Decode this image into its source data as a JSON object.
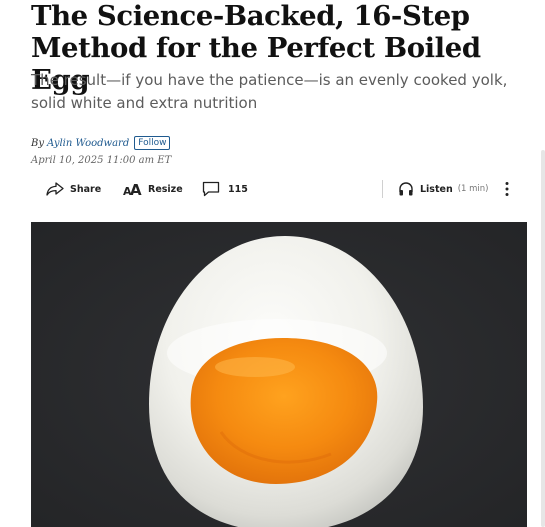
{
  "article": {
    "headline": "The Science-Backed, 16-Step Method for the Perfect Boiled Egg",
    "dek": "The result—if you have the patience—is an evenly cooked yolk, solid white and extra nutrition",
    "by_prefix": "By",
    "author": "Aylin Woodward",
    "follow_label": "Follow",
    "date": "April 10, 2025 11:00 am ET"
  },
  "toolbar": {
    "share_label": "Share",
    "share_icon": "share-arrow-icon",
    "resize_label": "Resize",
    "resize_icon": "text-resize-icon",
    "comments_count": "115",
    "comments_icon": "speech-bubble-icon",
    "listen_label": "Listen",
    "listen_duration": "(1 min)",
    "listen_icon": "headphones-icon",
    "more_icon": "vertical-ellipsis-icon"
  },
  "hero_image": {
    "subject": "halved soft-boiled egg with orange yolk on dark background",
    "background_color": "#2a2b2d",
    "yolk_color": "#f08a12"
  }
}
